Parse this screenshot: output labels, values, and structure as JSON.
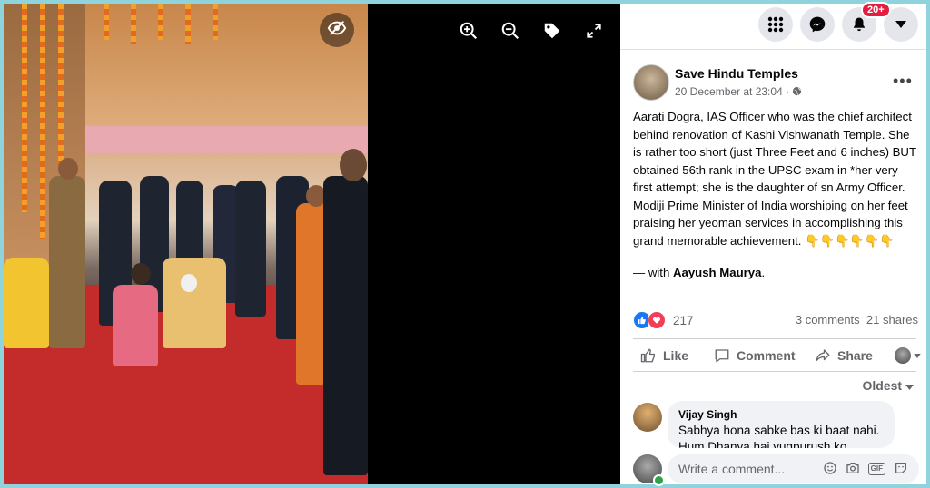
{
  "viewer": {
    "toolbar": {
      "hide_icon": "eye-slash-icon",
      "zoom_in_icon": "zoom-in-icon",
      "zoom_out_icon": "zoom-out-icon",
      "tag_icon": "tag-icon",
      "fullscreen_icon": "fullscreen-icon"
    }
  },
  "topbar": {
    "menu_icon": "grid-menu-icon",
    "messenger_icon": "messenger-icon",
    "notifications_icon": "bell-icon",
    "notifications_badge": "20+",
    "account_icon": "caret-down-icon"
  },
  "post": {
    "page_name": "Save Hindu Temples",
    "date": "20 December at 23:04 ·",
    "more": "•••",
    "text": "Aarati Dogra, IAS Officer who was the chief architect behind renovation of Kashi Vishwanath Temple. She is rather too short (just Three Feet and 6 inches) BUT obtained 56th rank in the UPSC exam in *her very first attempt; she is the daughter of sn Army Officer. Modiji Prime Minister of India worshiping on her feet praising her yeoman services in accomplishing this grand memorable achievement. 👇👇👇👇👇👇",
    "with_prefix": "— with ",
    "with_name": "Aayush Maurya",
    "with_suffix": ".",
    "reaction_count": "217",
    "comments_count": "3 comments",
    "shares_count": "21 shares",
    "actions": {
      "like": "Like",
      "comment": "Comment",
      "share": "Share"
    },
    "sort_label": "Oldest",
    "comments": [
      {
        "author": "Vijay Singh",
        "text": "Sabhya hona sabke bas ki baat nahi. Hum Dhanya hai yugpurush ko"
      }
    ],
    "write_placeholder": "Write a comment...",
    "gif_label": "GIF"
  },
  "colors": {
    "like_blue": "#1877f2",
    "love_red": "#f33e58",
    "badge_red": "#e41e3f",
    "frame": "#8fd3dd"
  }
}
